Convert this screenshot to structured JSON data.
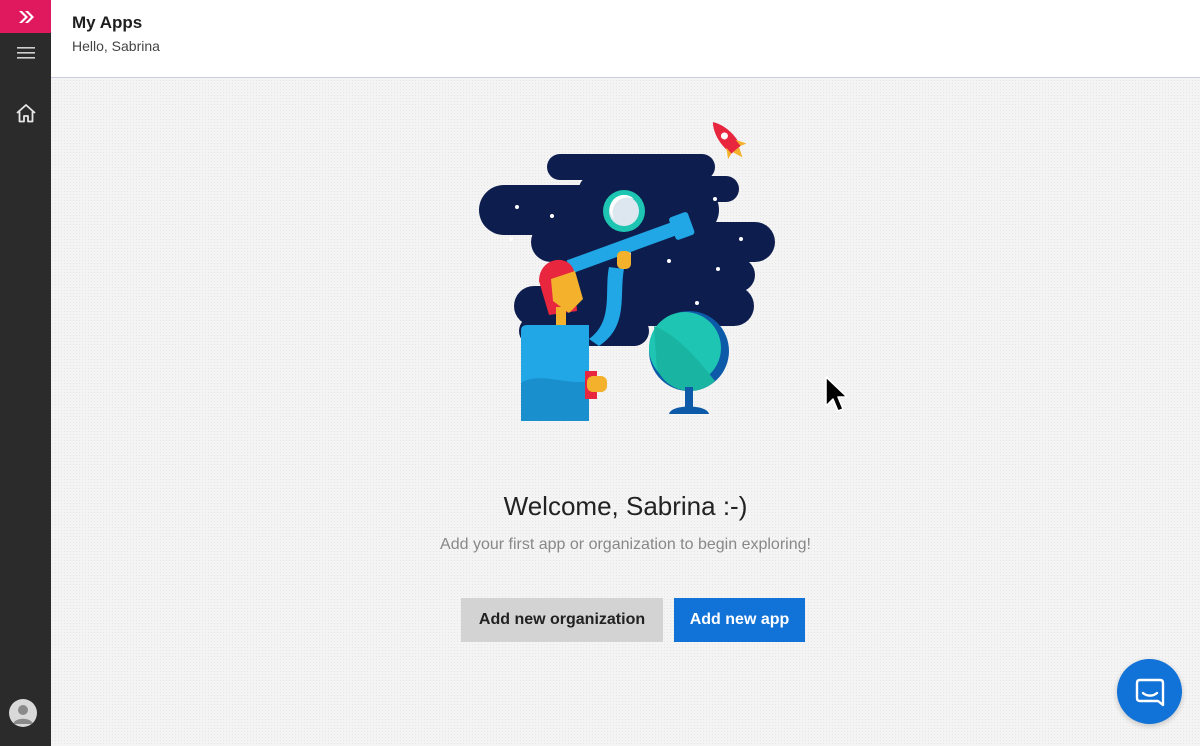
{
  "header": {
    "title": "My Apps",
    "greeting": "Hello, Sabrina"
  },
  "sidebar": {
    "items": [
      {
        "name": "menu",
        "icon": "hamburger-menu-icon"
      },
      {
        "name": "home",
        "icon": "home-icon"
      }
    ],
    "brand_icon": "app-logo-icon",
    "avatar_icon": "user-avatar-icon"
  },
  "main": {
    "welcome": "Welcome, Sabrina :-)",
    "subtitle": "Add your first app or organization to begin exploring!",
    "buttons": {
      "add_org": "Add new organization",
      "add_app": "Add new app"
    }
  },
  "chat": {
    "icon": "chat-bubble-icon"
  },
  "colors": {
    "brand": "#e0195e",
    "sidebar": "#2b2b2b",
    "primary": "#1172d8",
    "secondary_button": "#d3d3d3",
    "illustration_sky": "#0d1d4d"
  }
}
